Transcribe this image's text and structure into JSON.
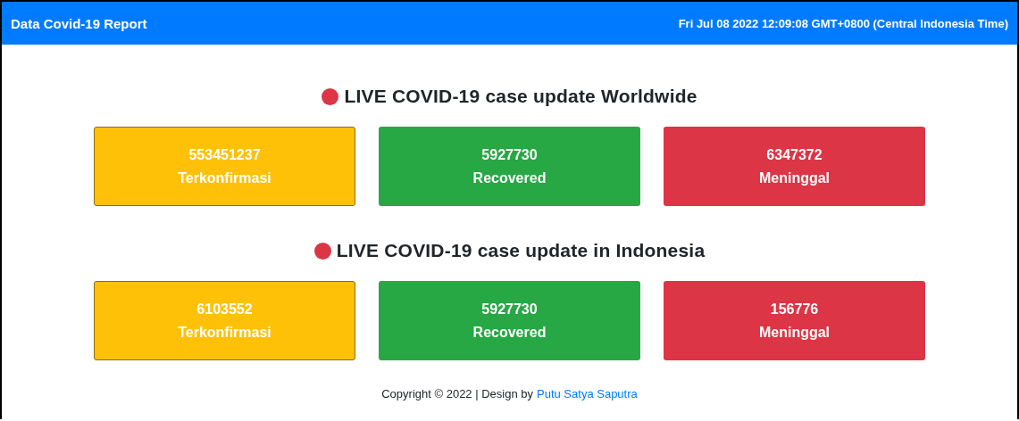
{
  "navbar": {
    "brand": "Data Covid-19 Report",
    "datetime": "Fri Jul 08 2022 12:09:08 GMT+0800 (Central Indonesia Time)"
  },
  "sections": [
    {
      "title": "LIVE COVID-19 case update Worldwide",
      "cards": [
        {
          "kind": "confirmed",
          "count": "553451237",
          "label": "Terkonfirmasi"
        },
        {
          "kind": "recovered",
          "count": "5927730",
          "label": "Recovered"
        },
        {
          "kind": "deaths",
          "count": "6347372",
          "label": "Meninggal"
        }
      ]
    },
    {
      "title": "LIVE COVID-19 case update in Indonesia",
      "cards": [
        {
          "kind": "confirmed",
          "count": "6103552",
          "label": "Terkonfirmasi"
        },
        {
          "kind": "recovered",
          "count": "5927730",
          "label": "Recovered"
        },
        {
          "kind": "deaths",
          "count": "156776",
          "label": "Meninggal"
        }
      ]
    }
  ],
  "footer": {
    "text": "Copyright © 2022 | Design by",
    "link": "Putu Satya Saputra"
  }
}
